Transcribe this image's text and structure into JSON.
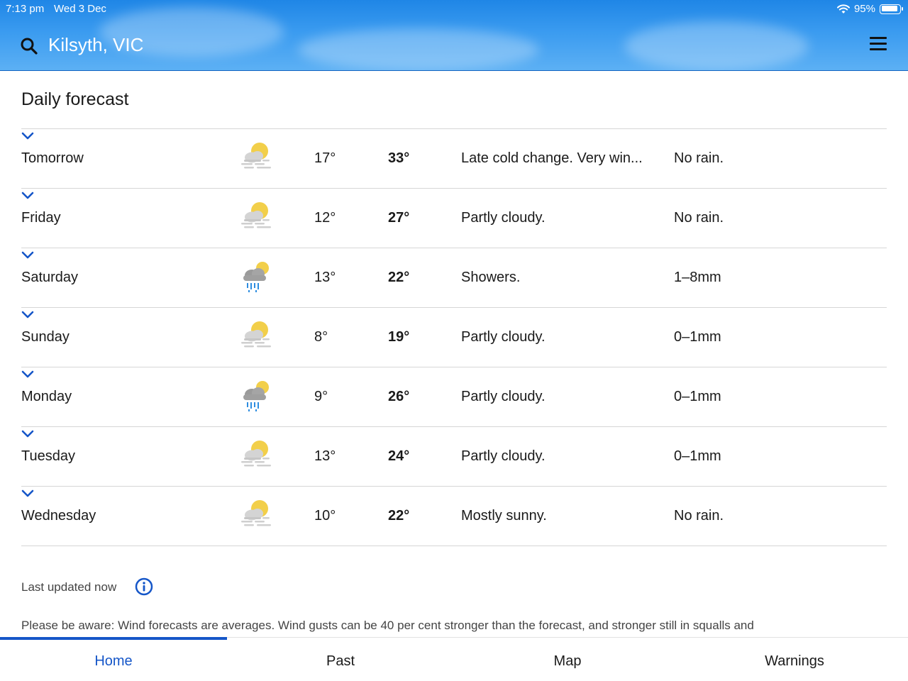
{
  "status_bar": {
    "time": "7:13 pm",
    "date": "Wed 3 Dec",
    "battery": "95%"
  },
  "header": {
    "location": "Kilsyth, VIC",
    "search_icon": "search-icon",
    "menu_icon": "menu-icon"
  },
  "main": {
    "title": "Daily forecast",
    "days": [
      {
        "day": "Tomorrow",
        "icon": "partly-cloudy-icon",
        "min": "17°",
        "max": "33°",
        "summary": "Late cold change. Very win...",
        "rain": "No rain."
      },
      {
        "day": "Friday",
        "icon": "partly-cloudy-icon",
        "min": "12°",
        "max": "27°",
        "summary": "Partly cloudy.",
        "rain": "No rain."
      },
      {
        "day": "Saturday",
        "icon": "showers-icon",
        "min": "13°",
        "max": "22°",
        "summary": "Showers.",
        "rain": "1–8mm"
      },
      {
        "day": "Sunday",
        "icon": "partly-cloudy-icon",
        "min": "8°",
        "max": "19°",
        "summary": "Partly cloudy.",
        "rain": "0–1mm"
      },
      {
        "day": "Monday",
        "icon": "showers-icon",
        "min": "9°",
        "max": "26°",
        "summary": "Partly cloudy.",
        "rain": "0–1mm"
      },
      {
        "day": "Tuesday",
        "icon": "partly-cloudy-icon",
        "min": "13°",
        "max": "24°",
        "summary": "Partly cloudy.",
        "rain": "0–1mm"
      },
      {
        "day": "Wednesday",
        "icon": "partly-cloudy-icon",
        "min": "10°",
        "max": "22°",
        "summary": "Mostly sunny.",
        "rain": "No rain."
      }
    ],
    "last_updated": "Last updated now",
    "disclaimer": "Please be aware: Wind forecasts are averages. Wind gusts can be 40 per cent stronger than the forecast, and stronger still in squalls and"
  },
  "tabs": [
    {
      "label": "Home",
      "active": true
    },
    {
      "label": "Past",
      "active": false
    },
    {
      "label": "Map",
      "active": false
    },
    {
      "label": "Warnings",
      "active": false
    }
  ],
  "colors": {
    "accent": "#1556c8",
    "header_blue": "#2b8fea",
    "divider": "#d6d6d6"
  }
}
